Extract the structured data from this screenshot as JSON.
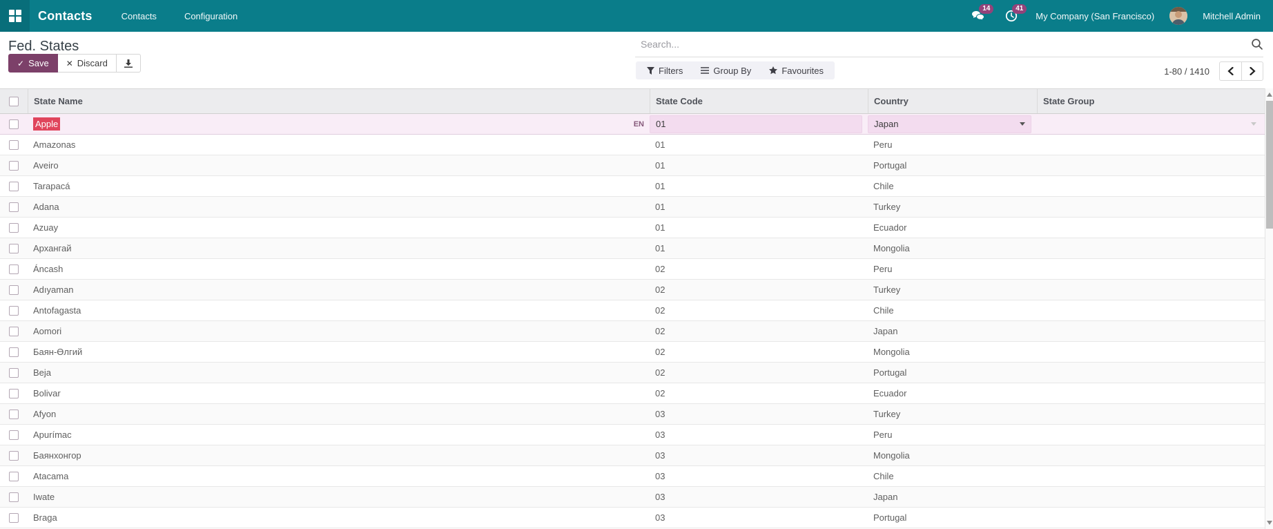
{
  "navbar": {
    "brand": "Contacts",
    "menu_contacts": "Contacts",
    "menu_configuration": "Configuration",
    "messages_count": "14",
    "activities_count": "41",
    "company": "My Company (San Francisco)",
    "user": "Mitchell Admin"
  },
  "control_panel": {
    "title": "Fed. States",
    "save_label": "Save",
    "discard_label": "Discard",
    "search_placeholder": "Search...",
    "filters_label": "Filters",
    "group_by_label": "Group By",
    "favourites_label": "Favourites",
    "pager_text": "1-80 / 1410"
  },
  "table": {
    "columns": {
      "name": "State Name",
      "code": "State Code",
      "country": "Country",
      "group": "State Group"
    },
    "edit_row": {
      "name": "Apple",
      "lang_badge": "EN",
      "code": "01",
      "country": "Japan",
      "state_group": ""
    },
    "rows": [
      {
        "name": "Amazonas",
        "code": "01",
        "country": "Peru"
      },
      {
        "name": "Aveiro",
        "code": "01",
        "country": "Portugal"
      },
      {
        "name": "Tarapacá",
        "code": "01",
        "country": "Chile"
      },
      {
        "name": "Adana",
        "code": "01",
        "country": "Turkey"
      },
      {
        "name": "Azuay",
        "code": "01",
        "country": "Ecuador"
      },
      {
        "name": "Архангай",
        "code": "01",
        "country": "Mongolia"
      },
      {
        "name": "Áncash",
        "code": "02",
        "country": "Peru"
      },
      {
        "name": "Adıyaman",
        "code": "02",
        "country": "Turkey"
      },
      {
        "name": "Antofagasta",
        "code": "02",
        "country": "Chile"
      },
      {
        "name": "Aomori",
        "code": "02",
        "country": "Japan"
      },
      {
        "name": "Баян-Өлгий",
        "code": "02",
        "country": "Mongolia"
      },
      {
        "name": "Beja",
        "code": "02",
        "country": "Portugal"
      },
      {
        "name": "Bolivar",
        "code": "02",
        "country": "Ecuador"
      },
      {
        "name": "Afyon",
        "code": "03",
        "country": "Turkey"
      },
      {
        "name": "Apurímac",
        "code": "03",
        "country": "Peru"
      },
      {
        "name": "Баянхонгор",
        "code": "03",
        "country": "Mongolia"
      },
      {
        "name": "Atacama",
        "code": "03",
        "country": "Chile"
      },
      {
        "name": "Iwate",
        "code": "03",
        "country": "Japan"
      },
      {
        "name": "Braga",
        "code": "03",
        "country": "Portugal"
      }
    ]
  },
  "colors": {
    "navbar_teal": "#0a7d8a",
    "apps_square_teal": "#086e7a",
    "badge_plum": "#93437a",
    "primary_button_purple": "#7c4069",
    "edit_row_pink": "#f9edf7",
    "edit_input_pink": "#f3dcef",
    "text_selection_red": "#e0455c",
    "header_gray": "#ececee"
  }
}
